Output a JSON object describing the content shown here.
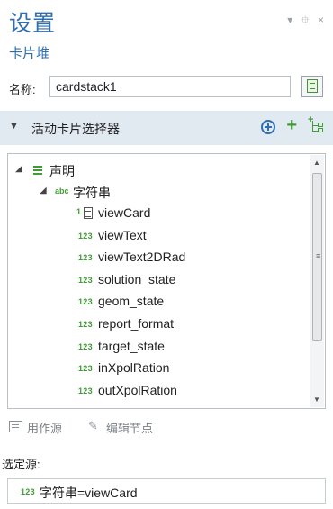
{
  "window": {
    "title": "设置",
    "controls": [
      "▾",
      "⯐",
      "×"
    ]
  },
  "subtitle": "卡片堆",
  "name_field": {
    "label": "名称:",
    "value": "cardstack1"
  },
  "section": {
    "title": "活动卡片选择器"
  },
  "tree": {
    "root": {
      "label": "声明"
    },
    "group": {
      "tag": "abc",
      "label": "字符串"
    },
    "items": [
      {
        "tag": "1",
        "label": "viewCard"
      },
      {
        "tag": "123",
        "label": "viewText"
      },
      {
        "tag": "123",
        "label": "viewText2DRad"
      },
      {
        "tag": "123",
        "label": "solution_state"
      },
      {
        "tag": "123",
        "label": "geom_state"
      },
      {
        "tag": "123",
        "label": "report_format"
      },
      {
        "tag": "123",
        "label": "target_state"
      },
      {
        "tag": "123",
        "label": "inXpolRation"
      },
      {
        "tag": "123",
        "label": "outXpolRation"
      }
    ]
  },
  "actions": {
    "use_as_source": "用作源",
    "edit_node": "编辑节点"
  },
  "selected_source": {
    "label": "选定源:",
    "tag": "123",
    "value": "字符串=viewCard"
  }
}
